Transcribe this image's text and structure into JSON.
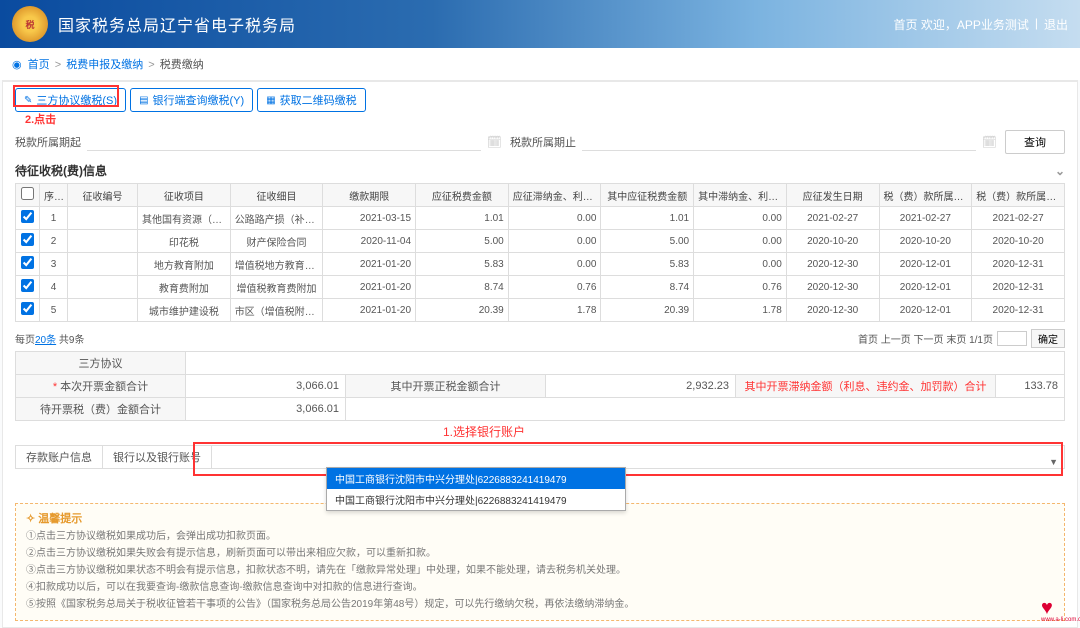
{
  "header": {
    "title": "国家税务总局辽宁省电子税务局",
    "welcome": "首页  欢迎，APP业务测试",
    "logout": "退出"
  },
  "breadcrumb": {
    "home": "首页",
    "l1": "税费申报及缴纳",
    "l2": "税费缴纳"
  },
  "tabs": {
    "t1": "三方协议缴税(S)",
    "t2": "银行端查询缴税(Y)",
    "t3": "获取二维码缴税"
  },
  "filters": {
    "start_label": "税款所属期起",
    "end_label": "税款所属期止",
    "query": "查询"
  },
  "section_title": "待征收税(费)信息",
  "columns": [
    "序号",
    "征收编号",
    "征收项目",
    "征收细目",
    "缴款期限",
    "应征税费金额",
    "应征滞纳金、利息、违约",
    "其中应征税费金额",
    "其中滞纳金、利息、违约",
    "应征发生日期",
    "税（费）款所属期起",
    "税（费）款所属期止"
  ],
  "rows": [
    {
      "n": "1",
      "a": "",
      "b": "其他国有资源（资产）有偿使用...",
      "c": "公路路产损（补）修费",
      "d": "2021-03-15",
      "e": "1.01",
      "f": "0.00",
      "g": "1.01",
      "h": "0.00",
      "i": "2021-02-27",
      "j": "2021-02-27",
      "k": "2021-02-27"
    },
    {
      "n": "2",
      "a": "",
      "b": "印花税",
      "c": "财产保险合同",
      "d": "2020-11-04",
      "e": "5.00",
      "f": "0.00",
      "g": "5.00",
      "h": "0.00",
      "i": "2020-10-20",
      "j": "2020-10-20",
      "k": "2020-10-20"
    },
    {
      "n": "3",
      "a": "",
      "b": "地方教育附加",
      "c": "增值税地方教育附加",
      "d": "2021-01-20",
      "e": "5.83",
      "f": "0.00",
      "g": "5.83",
      "h": "0.00",
      "i": "2020-12-30",
      "j": "2020-12-01",
      "k": "2020-12-31"
    },
    {
      "n": "4",
      "a": "",
      "b": "教育费附加",
      "c": "增值税教育费附加",
      "d": "2021-01-20",
      "e": "8.74",
      "f": "0.76",
      "g": "8.74",
      "h": "0.76",
      "i": "2020-12-30",
      "j": "2020-12-01",
      "k": "2020-12-31"
    },
    {
      "n": "5",
      "a": "",
      "b": "城市维护建设税",
      "c": "市区（增值税附征）",
      "d": "2021-01-20",
      "e": "20.39",
      "f": "1.78",
      "g": "20.39",
      "h": "1.78",
      "i": "2020-12-30",
      "j": "2020-12-01",
      "k": "2020-12-31"
    }
  ],
  "pager": {
    "left_pre": "每页",
    "left_link": "20条",
    "left_post": " 共9条",
    "nav": "首页 上一页 下一页 末页 1/1页",
    "confirm": "确定"
  },
  "summary": {
    "r1_lbl": "三方协议",
    "r2_lbl": "本次开票金额合计",
    "r2_val1": "3,066.01",
    "r2_lbl2": "其中开票正税金额合计",
    "r2_val2": "2,932.23",
    "r2_lbl3": "其中开票滞纳金额（利息、违约金、加罚款）合计",
    "r2_val3": "133.78",
    "r3_lbl": "待开票税（费）金额合计",
    "r3_val": "3,066.01"
  },
  "annotations": {
    "click": "2.点击",
    "select_bank": "1.选择银行账户"
  },
  "bank": {
    "lbl1": "存款账户信息",
    "lbl2": "银行以及银行账号",
    "selected": "中国工商银行沈阳市中兴分理处|6226883241419479",
    "option2": "中国工商银行沈阳市中兴分理处|6226883241419479"
  },
  "tips": {
    "title": "温馨提示",
    "p1": "①点击三方协议缴税如果成功后，会弹出成功扣款页面。",
    "p2": "②点击三方协议缴税如果失败会有提示信息，刷新页面可以带出来相应欠款，可以重新扣款。",
    "p3": "③点击三方协议缴税如果状态不明会有提示信息，扣款状态不明，请先在「缴款异常处理」中处理，如果不能处理，请去税务机关处理。",
    "p4": "④扣款成功以后，可以在我要查询-缴款信息查询-缴款信息查询中对扣款的信息进行查询。",
    "p5": "⑤按照《国家税务总局关于税收征管若干事项的公告》（国家税务总局公告2019年第48号）规定，可以先行缴纳欠税，再依法缴纳滞纳金。"
  },
  "footer_logo_txt": "www.a-li.com.cn"
}
